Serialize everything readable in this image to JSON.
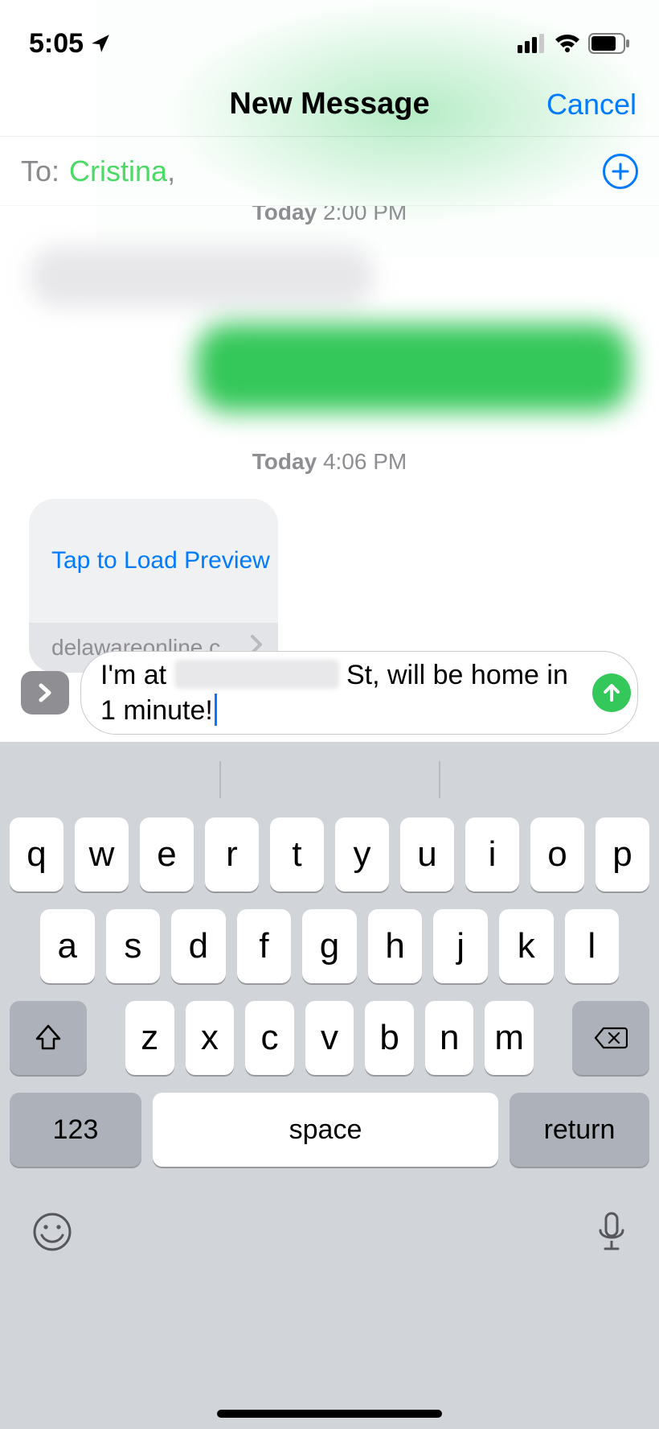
{
  "status": {
    "time": "5:05"
  },
  "nav": {
    "title": "New Message",
    "cancel": "Cancel"
  },
  "to": {
    "label": "To:",
    "recipient": "Cristina"
  },
  "thread": {
    "prior_time_day": "Today",
    "prior_time_val": "2:00 PM",
    "timestamp_day": "Today",
    "timestamp_time": "4:06 PM",
    "link_preview_cta": "Tap to Load Preview",
    "link_domain": "delawareonline.c..."
  },
  "composer": {
    "text_prefix": "I'm at ",
    "text_suffix": " St, will be home in 1 minute!"
  },
  "keyboard": {
    "row1": [
      "q",
      "w",
      "e",
      "r",
      "t",
      "y",
      "u",
      "i",
      "o",
      "p"
    ],
    "row2": [
      "a",
      "s",
      "d",
      "f",
      "g",
      "h",
      "j",
      "k",
      "l"
    ],
    "row3": [
      "z",
      "x",
      "c",
      "v",
      "b",
      "n",
      "m"
    ],
    "num": "123",
    "space": "space",
    "ret": "return"
  }
}
